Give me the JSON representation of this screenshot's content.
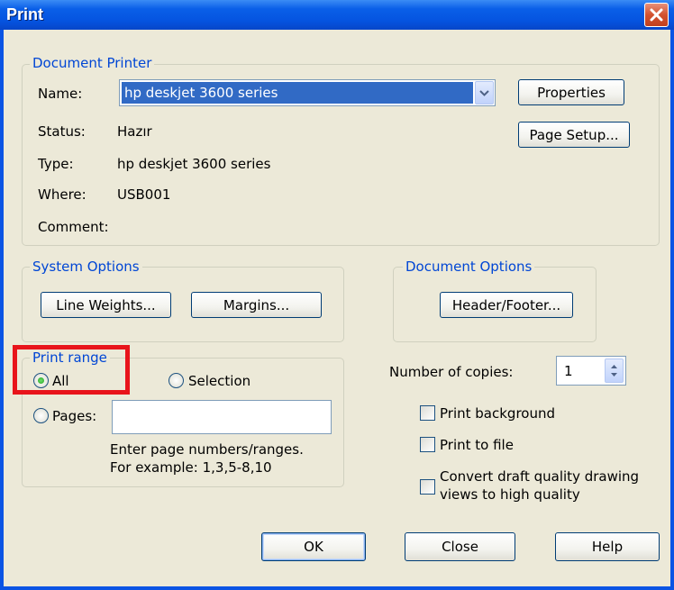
{
  "window": {
    "title": "Print"
  },
  "document_printer": {
    "legend": "Document Printer",
    "name_label": "Name:",
    "name_value": "hp deskjet 3600 series",
    "status_label": "Status:",
    "status_value": "Hazır",
    "type_label": "Type:",
    "type_value": "hp deskjet 3600 series",
    "where_label": "Where:",
    "where_value": "USB001",
    "comment_label": "Comment:",
    "comment_value": "",
    "properties_button": "Properties",
    "page_setup_button": "Page Setup..."
  },
  "system_options": {
    "legend": "System Options",
    "line_weights_button": "Line Weights...",
    "margins_button": "Margins..."
  },
  "document_options": {
    "legend": "Document Options",
    "header_footer_button": "Header/Footer..."
  },
  "print_range": {
    "legend": "Print range",
    "all_label": "All",
    "all_selected": true,
    "selection_label": "Selection",
    "pages_label": "Pages:",
    "pages_value": "",
    "hint_line1": "Enter page numbers/ranges.",
    "hint_line2": "For example: 1,3,5-8,10"
  },
  "copies": {
    "label": "Number of copies:",
    "value": "1"
  },
  "options": {
    "print_background": "Print background",
    "print_to_file": "Print to file",
    "convert_line1": "Convert draft quality drawing",
    "convert_line2": "views to high quality"
  },
  "buttons": {
    "ok": "OK",
    "close": "Close",
    "help": "Help"
  },
  "colors": {
    "titlebar": "#0a54e4",
    "legend_text": "#0046d5",
    "highlight_box": "#e8141b",
    "selection": "#316ac5"
  }
}
